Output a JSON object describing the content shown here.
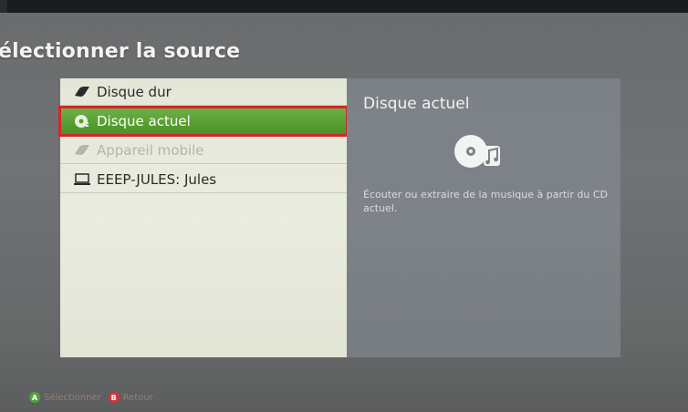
{
  "header": {
    "title": "électionner la source"
  },
  "sources": [
    {
      "label": "Disque dur",
      "icon": "hard-drive-icon",
      "state": "normal"
    },
    {
      "label": "Disque actuel",
      "icon": "disc-icon",
      "state": "selected"
    },
    {
      "label": "Appareil mobile",
      "icon": "mobile-device-icon",
      "state": "disabled"
    },
    {
      "label": "EEEP-JULES: Jules",
      "icon": "computer-icon",
      "state": "normal"
    }
  ],
  "detail": {
    "title": "Disque actuel",
    "icon": "disc-music-icon",
    "description": "Écouter ou extraire de la musique à partir du CD actuel."
  },
  "footer": {
    "select_button": "A",
    "select_label": "Sélectionner",
    "back_button": "B",
    "back_label": "Retour"
  },
  "colors": {
    "selection": "#58a032",
    "highlight_border": "#d8242a",
    "list_bg": "#e6e9dc",
    "detail_bg": "#7b8186"
  }
}
